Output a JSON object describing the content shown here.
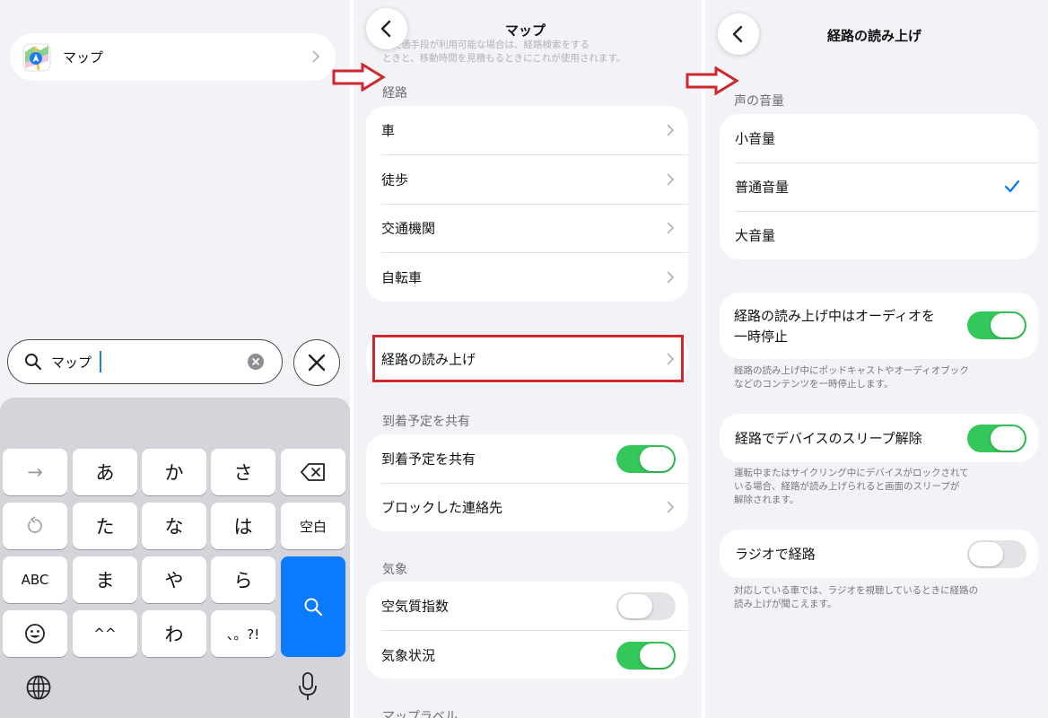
{
  "panel1": {
    "result_label": "マップ",
    "search_value": "マップ",
    "keyboard": {
      "row1": [
        "→",
        "あ",
        "か",
        "さ"
      ],
      "row2": [
        "た",
        "な",
        "は",
        "空白"
      ],
      "row3": [
        "ABC",
        "ま",
        "や",
        "ら"
      ],
      "row4": [
        "^^",
        "わ",
        "、。?!"
      ]
    }
  },
  "panel2": {
    "title": "マップ",
    "faded_text_1": "の交通手段が利用可能な場合は、経路検索をする",
    "faded_text_2": "ときと、移動時間を見積もるときにこれが使用されます。",
    "route_header": "経路",
    "route_items": [
      "車",
      "徒歩",
      "交通機関",
      "自転車"
    ],
    "voice_item": "経路の読み上げ",
    "share_header": "到着予定を共有",
    "share_toggle_label": "到着予定を共有",
    "share_toggle_on": true,
    "blocked_label": "ブロックした連絡先",
    "weather_header": "気象",
    "air_quality_label": "空気質指数",
    "air_quality_on": false,
    "weather_label": "気象状況",
    "weather_on": true,
    "map_labels_header": "マップラベル"
  },
  "panel3": {
    "title": "経路の読み上げ",
    "volume_header": "声の音量",
    "volume_options": [
      "小音量",
      "普通音量",
      "大音量"
    ],
    "selected_volume_index": 1,
    "pause_audio_label_1": "経路の読み上げ中はオーディオを",
    "pause_audio_label_2": "一時停止",
    "pause_audio_on": true,
    "pause_audio_footer_1": "経路の読み上げ中にポッドキャストやオーディオブック",
    "pause_audio_footer_2": "などのコンテンツを一時停止します。",
    "wake_label": "経路でデバイスのスリープ解除",
    "wake_on": true,
    "wake_footer_1": "運転中またはサイクリング中にデバイスがロックされて",
    "wake_footer_2": "いる場合、経路が読み上げられると画面のスリープが",
    "wake_footer_3": "解除されます。",
    "radio_label": "ラジオで経路",
    "radio_on": false,
    "radio_footer_1": "対応している車では、ラジオを視聴しているときに経路の",
    "radio_footer_2": "読み上げが聞こえます。"
  },
  "colors": {
    "accent": "#007aff",
    "toggle_on": "#34c759",
    "highlight_box": "#d0262d",
    "arrow": "#d0262d"
  }
}
